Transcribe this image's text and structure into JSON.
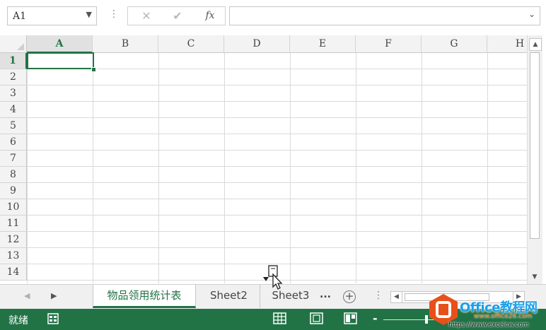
{
  "formula_bar": {
    "name_box": "A1",
    "name_box_icon": "chevron-down-icon",
    "dots": "⋮",
    "cancel_icon": "close-icon",
    "enter_icon": "check-icon",
    "function_label": "fx",
    "formula_value": "",
    "expand_icon": "chevron-down-icon"
  },
  "grid": {
    "columns": [
      "A",
      "B",
      "C",
      "D",
      "E",
      "F",
      "G",
      "H"
    ],
    "rows": [
      "1",
      "2",
      "3",
      "4",
      "5",
      "6",
      "7",
      "8",
      "9",
      "10",
      "11",
      "12",
      "13",
      "14"
    ],
    "active_column": "A",
    "active_row": "1",
    "accent_color": "#217346"
  },
  "sheet_tabs": {
    "tabs": [
      "物品领用统计表",
      "Sheet2",
      "Sheet3"
    ],
    "active_index": 0,
    "more_label": "...",
    "new_sheet_label": "+"
  },
  "status_bar": {
    "status": "就绪",
    "zoom_minus": "-",
    "background_color": "#217346"
  },
  "watermark": {
    "title": "Office教程网",
    "subtitle": "www.office26.com",
    "url": "https://www.excelcw.com"
  }
}
